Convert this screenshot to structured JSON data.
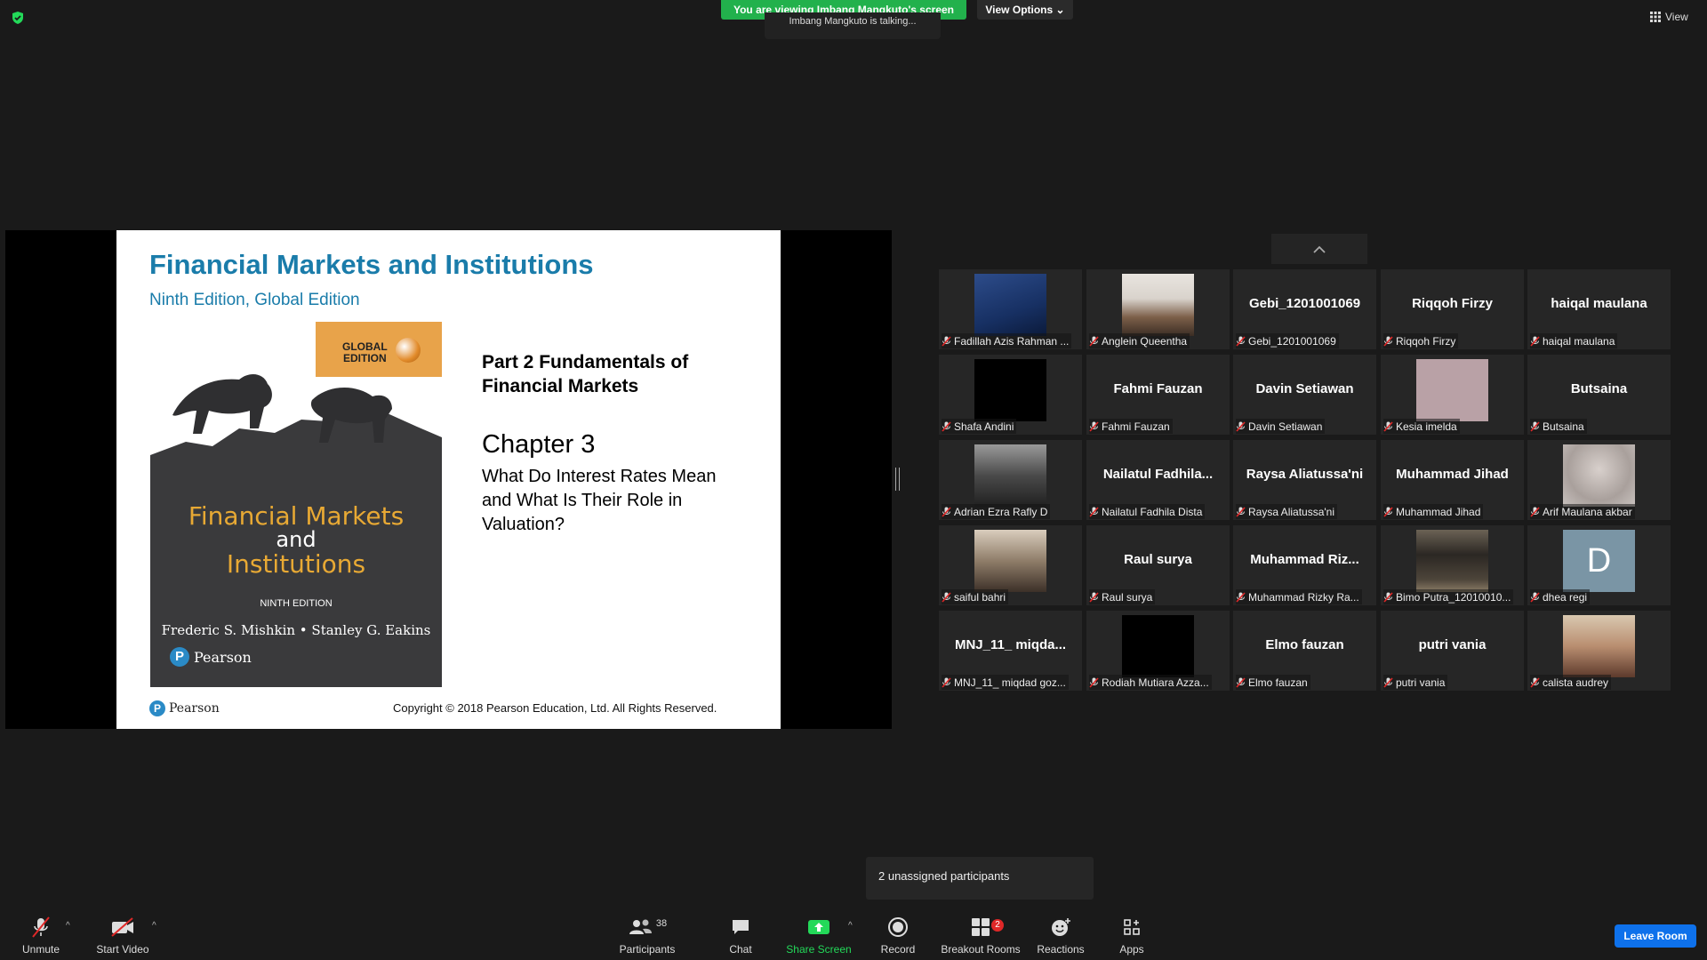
{
  "top": {
    "banner": "You are viewing Imbang Mangkuto's screen",
    "view_options": "View Options",
    "talking": "Imbang Mangkuto is talking...",
    "view": "View"
  },
  "slide": {
    "title": "Financial Markets and Institutions",
    "subtitle": "Ninth Edition, Global Edition",
    "badge": "GLOBAL\nEDITION",
    "cover_title_1": "Financial Markets",
    "cover_title_and": "and",
    "cover_title_2": "Institutions",
    "cover_edition": "NINTH EDITION",
    "cover_authors": "Frederic S. Mishkin • Stanley G. Eakins",
    "cover_publisher": "Pearson",
    "part": "Part 2 Fundamentals of Financial Markets",
    "chapter": "Chapter 3",
    "chapter_subtitle": "What Do Interest Rates Mean and What Is Their Role in Valuation?",
    "footer_publisher": "Pearson",
    "copyright": "Copyright © 2018 Pearson Education, Ltd. All Rights Reserved."
  },
  "participants": [
    {
      "tile": "",
      "label": "Fadillah Azis Rahman ...",
      "thumb": "blue"
    },
    {
      "tile": "",
      "label": "Anglein Queentha",
      "thumb": "room"
    },
    {
      "tile": "Gebi_1201001069",
      "label": "Gebi_1201001069"
    },
    {
      "tile": "Riqqoh Firzy",
      "label": "Riqqoh Firzy"
    },
    {
      "tile": "haiqal maulana",
      "label": "haiqal maulana"
    },
    {
      "tile": "",
      "label": "Shafa Andini",
      "thumb": "black"
    },
    {
      "tile": "Fahmi Fauzan",
      "label": "Fahmi Fauzan"
    },
    {
      "tile": "Davin Setiawan",
      "label": "Davin Setiawan"
    },
    {
      "tile": "",
      "label": "Kesia imelda",
      "thumb": "pink"
    },
    {
      "tile": "Butsaina",
      "label": "Butsaina"
    },
    {
      "tile": "",
      "label": "Adrian Ezra Rafly D",
      "thumb": "gray"
    },
    {
      "tile": "Nailatul  Fadhila...",
      "label": "Nailatul Fadhila Dista"
    },
    {
      "tile": "Raysa Aliatussa'ni",
      "label": "Raysa Aliatussa'ni"
    },
    {
      "tile": "Muhammad Jihad",
      "label": "Muhammad Jihad"
    },
    {
      "tile": "",
      "label": "Arif Maulana akbar",
      "thumb": "blur"
    },
    {
      "tile": "",
      "label": "saiful bahri",
      "thumb": "photo"
    },
    {
      "tile": "Raul surya",
      "label": "Raul surya"
    },
    {
      "tile": "Muhammad  Riz...",
      "label": "Muhammad Rizky Ra..."
    },
    {
      "tile": "",
      "label": "Bimo Putra_12010010...",
      "thumb": "street"
    },
    {
      "tile": "",
      "label": "dhea regi",
      "thumb": "avatar",
      "avatar_letter": "D"
    },
    {
      "tile": "MNJ_11_  miqda...",
      "label": "MNJ_11_ miqdad goz..."
    },
    {
      "tile": "",
      "label": "Rodiah Mutiara Azza...",
      "thumb": "black"
    },
    {
      "tile": "Elmo fauzan",
      "label": "Elmo fauzan"
    },
    {
      "tile": "putri vania",
      "label": "putri vania"
    },
    {
      "tile": "",
      "label": "calista audrey",
      "thumb": "selfie"
    }
  ],
  "toast": "2 unassigned participants",
  "toolbar": {
    "unmute": "Unmute",
    "start_video": "Start Video",
    "participants": "Participants",
    "participants_count": "38",
    "chat": "Chat",
    "share_screen": "Share Screen",
    "record": "Record",
    "breakout_rooms": "Breakout Rooms",
    "breakout_badge": "2",
    "reactions": "Reactions",
    "apps": "Apps",
    "leave": "Leave Room"
  },
  "colors": {
    "banner_green": "#22b14c",
    "slide_blue": "#1a7caa",
    "leave_blue": "#0e71eb",
    "share_green": "#23d959",
    "muted_red": "#e02828"
  }
}
